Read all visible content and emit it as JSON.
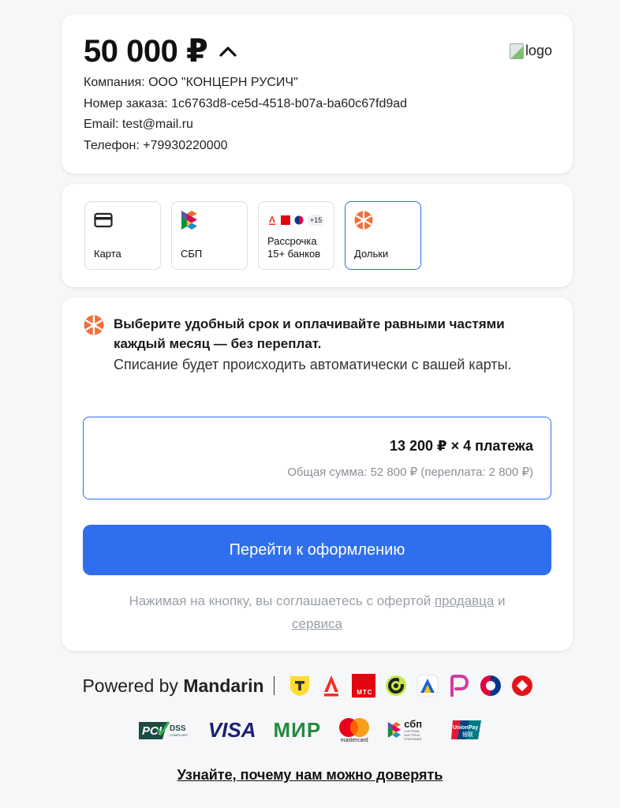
{
  "order": {
    "amount": "50 000 ₽",
    "logo_alt": "logo",
    "company": "Компания: ООО \"КОНЦЕРН РУСИЧ\"",
    "order_number": "Номер заказа: 1c6763d8-ce5d-4518-b07a-ba60c67fd9ad",
    "email": "Email: test@mail.ru",
    "phone": "Телефон: +79930220000"
  },
  "methods": [
    {
      "label": "Карта",
      "icon": "card-icon"
    },
    {
      "label": "СБП",
      "icon": "sbp-icon"
    },
    {
      "label": "Рассрочка\n15+ банков",
      "icon": "banks-icon",
      "extra": "+15"
    },
    {
      "label": "Дольки",
      "icon": "dolyami-icon",
      "selected": true
    }
  ],
  "dolyami": {
    "heading": "Выберите удобный срок и оплачивайте равными частями каждый месяц — без переплат.",
    "sub": "Списание будет происходить автоматически с вашей карты.",
    "plan_main": "13 200 ₽ × 4 платежа",
    "plan_total": "Общая сумма: 52 800 ₽ (переплата: 2 800 ₽)",
    "cta": "Перейти к оформлению",
    "terms_prefix": "Нажимая на кнопку, вы соглашаетесь с офертой ",
    "terms_link1": "продавца",
    "terms_mid": " и ",
    "terms_link2": "сервиса"
  },
  "footer": {
    "powered_prefix": "Powered by ",
    "powered_brand": "Mandarin",
    "mts_text": "МТС",
    "pci_text": "PCI",
    "dss_text": "DSS",
    "dss_sub": "COMPLIANT",
    "visa": "VISA",
    "mir": "МИР",
    "mastercard": "mastercard",
    "sbp": "сбп",
    "sbp_sub": "СИСТЕМА БЫСТРЫХ ПЛАТЕЖЕЙ",
    "unionpay": "UnionPay",
    "unionpay_cn": "银联",
    "trust_link": "Узнайте, почему нам можно доверять"
  },
  "colors": {
    "accent": "#2f6fed",
    "dolyami": "#f06f3a"
  }
}
